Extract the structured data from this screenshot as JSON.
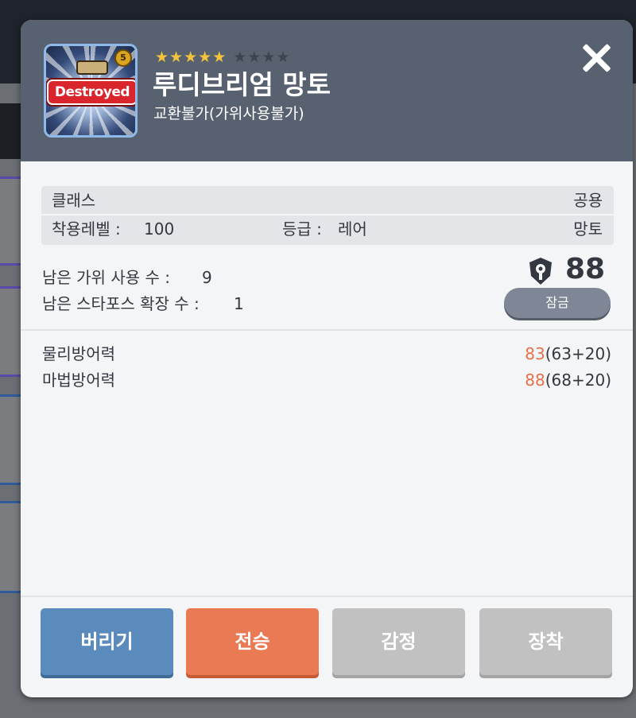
{
  "item": {
    "stars_on": 5,
    "stars_off": 4,
    "name": "루디브리엄 망토",
    "trade_status": "교환불가(가위사용불가)",
    "icon_overlay": "Destroyed",
    "icon_badge": "5"
  },
  "info": {
    "class_label": "클래스",
    "class_value": "공용",
    "level_label": "착용레벨 :",
    "level_value": "100",
    "grade_label": "등급 :",
    "grade_value": "레어",
    "type_value": "망토"
  },
  "usage": {
    "scissors_label": "남은 가위 사용 수 :",
    "scissors_value": "9",
    "starforce_label": "남은 스타포스 확장 수 :",
    "starforce_value": "1",
    "power_score": "88",
    "lock_label": "잠금"
  },
  "stats": [
    {
      "label": "물리방어력",
      "total": "83",
      "detail": "(63+20)"
    },
    {
      "label": "마법방어력",
      "total": "88",
      "detail": "(68+20)"
    }
  ],
  "buttons": {
    "discard": "버리기",
    "transfer": "전승",
    "appraise": "감정",
    "equip": "장착"
  },
  "colors": {
    "header": "#576170",
    "accent_orange": "#ea7a54",
    "star_gold": "#f3c33e",
    "discard_blue": "#5b8bbd",
    "disabled_gray": "#c1c1c1"
  }
}
